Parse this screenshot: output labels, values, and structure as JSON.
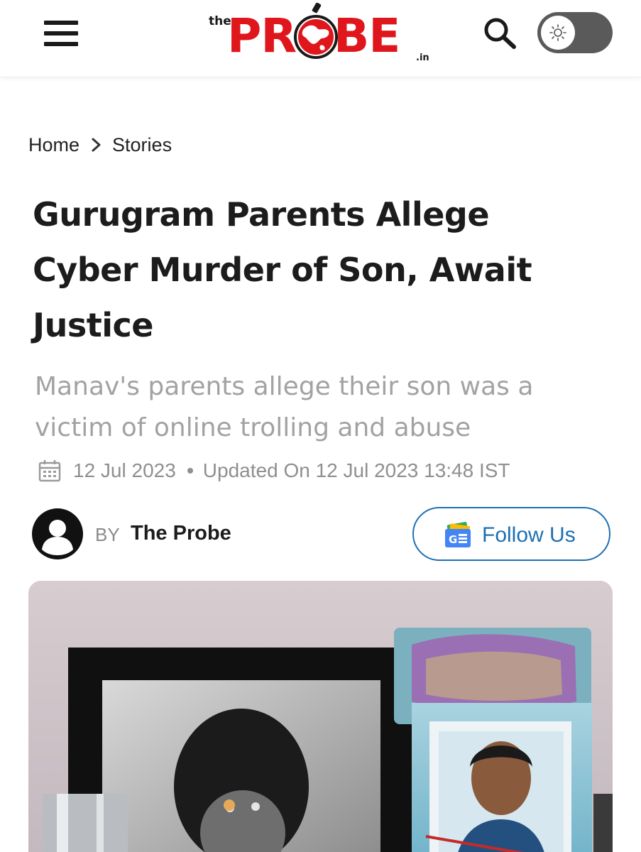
{
  "header": {
    "logo": {
      "prefix": "the",
      "part1": "PR",
      "part2": "BE",
      "tld": ".in"
    },
    "menu_icon": "hamburger-menu-icon",
    "search_icon": "search-icon",
    "theme_icon": "sun-icon"
  },
  "breadcrumb": {
    "home": "Home",
    "current": "Stories"
  },
  "article": {
    "title": "Gurugram Parents Allege Cyber Murder of Son, Await Justice",
    "subtitle": "Manav's parents allege their son was a victim of online trolling and abuse",
    "published": "12 Jul 2023",
    "updated": "Updated On 12 Jul 2023 13:48 IST",
    "byline_prefix": "BY",
    "author": "The Probe",
    "follow_label": "Follow Us"
  },
  "colors": {
    "brand_red": "#e0161d",
    "link_blue": "#1d6fb2"
  }
}
